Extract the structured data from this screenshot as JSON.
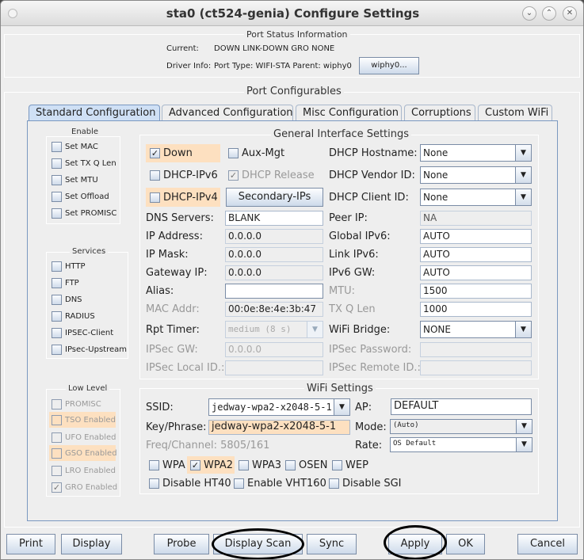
{
  "window": {
    "title": "sta0  (ct524-genia) Configure Settings",
    "controls": [
      "minimize",
      "maximize",
      "close"
    ]
  },
  "port_status": {
    "heading": "Port Status Information",
    "current_label": "Current:",
    "current_value": "DOWN LINK-DOWN GRO  NONE",
    "driver_label": "Driver Info:",
    "driver_value": "Port Type: WIFI-STA   Parent: wiphy0",
    "wiphy_button": "wiphy0..."
  },
  "configurables_heading": "Port Configurables",
  "tabs": [
    {
      "label": "Standard Configuration",
      "active": true
    },
    {
      "label": "Advanced Configuration",
      "active": false
    },
    {
      "label": "Misc Configuration",
      "active": false
    },
    {
      "label": "Corruptions",
      "active": false
    },
    {
      "label": "Custom WiFi",
      "active": false
    }
  ],
  "enable": {
    "heading": "Enable",
    "items": [
      {
        "label": "Set MAC",
        "checked": false
      },
      {
        "label": "Set TX Q Len",
        "checked": false
      },
      {
        "label": "Set MTU",
        "checked": false
      },
      {
        "label": "Set Offload",
        "checked": false
      },
      {
        "label": "Set PROMISC",
        "checked": false
      }
    ]
  },
  "services": {
    "heading": "Services",
    "items": [
      {
        "label": "HTTP",
        "checked": false
      },
      {
        "label": "FTP",
        "checked": false
      },
      {
        "label": "DNS",
        "checked": false
      },
      {
        "label": "RADIUS",
        "checked": false
      },
      {
        "label": "IPSEC-Client",
        "checked": false
      },
      {
        "label": "IPsec-Upstream",
        "checked": false
      }
    ]
  },
  "low_level": {
    "heading": "Low Level",
    "items": [
      {
        "label": "PROMISC",
        "checked": false,
        "highlight": false
      },
      {
        "label": "TSO Enabled",
        "checked": false,
        "highlight": true
      },
      {
        "label": "UFO Enabled",
        "checked": false,
        "highlight": false
      },
      {
        "label": "GSO Enabled",
        "checked": false,
        "highlight": true
      },
      {
        "label": "LRO Enabled",
        "checked": false,
        "highlight": false
      },
      {
        "label": "GRO Enabled",
        "checked": true,
        "highlight": false
      }
    ]
  },
  "general": {
    "heading": "General Interface Settings",
    "down": {
      "label": "Down",
      "checked": true
    },
    "aux_mgt": {
      "label": "Aux-Mgt",
      "checked": false
    },
    "dhcp_ipv6": {
      "label": "DHCP-IPv6",
      "checked": false
    },
    "dhcp_release": {
      "label": "DHCP Release",
      "checked": true
    },
    "dhcp_ipv4": {
      "label": "DHCP-IPv4",
      "checked": false
    },
    "secondary_ips_button": "Secondary-IPs",
    "dhcp_hostname": {
      "label": "DHCP Hostname:",
      "value": "None"
    },
    "dhcp_vendor_id": {
      "label": "DHCP Vendor ID:",
      "value": "None"
    },
    "dhcp_client_id": {
      "label": "DHCP Client ID:",
      "value": "None"
    },
    "dns_servers": {
      "label": "DNS Servers:",
      "value": "BLANK"
    },
    "peer_ip": {
      "label": "Peer IP:",
      "value": "NA"
    },
    "ip_address": {
      "label": "IP Address:",
      "value": "0.0.0.0"
    },
    "global_ipv6": {
      "label": "Global IPv6:",
      "value": "AUTO"
    },
    "ip_mask": {
      "label": "IP Mask:",
      "value": "0.0.0.0"
    },
    "link_ipv6": {
      "label": "Link IPv6:",
      "value": "AUTO"
    },
    "gateway_ip": {
      "label": "Gateway IP:",
      "value": "0.0.0.0"
    },
    "ipv6_gw": {
      "label": "IPv6 GW:",
      "value": "AUTO"
    },
    "alias": {
      "label": "Alias:",
      "value": ""
    },
    "mtu": {
      "label": "MTU:",
      "value": "1500"
    },
    "mac_addr": {
      "label": "MAC Addr:",
      "value": "00:0e:8e:4e:3b:47"
    },
    "tx_q_len": {
      "label": "TX Q Len",
      "value": "1000"
    },
    "rpt_timer": {
      "label": "Rpt Timer:",
      "value": "medium  (8 s)"
    },
    "wifi_bridge": {
      "label": "WiFi Bridge:",
      "value": "NONE"
    },
    "ipsec_gw": {
      "label": "IPSec GW:",
      "value": "0.0.0.0"
    },
    "ipsec_password": {
      "label": "IPSec Password:",
      "value": ""
    },
    "ipsec_local_id": {
      "label": "IPSec Local ID.:",
      "value": ""
    },
    "ipsec_remote_id": {
      "label": "IPSec Remote ID.:",
      "value": ""
    }
  },
  "wifi": {
    "heading": "WiFi Settings",
    "ssid": {
      "label": "SSID:",
      "value": "jedway-wpa2-x2048-5-1"
    },
    "ap": {
      "label": "AP:",
      "value": "DEFAULT"
    },
    "key": {
      "label": "Key/Phrase:",
      "value": "jedway-wpa2-x2048-5-1"
    },
    "mode": {
      "label": "Mode:",
      "value": "(Auto)"
    },
    "freq": "Freq/Channel: 5805/161",
    "rate": {
      "label": "Rate:",
      "value": "OS Default"
    },
    "security": [
      {
        "label": "WPA",
        "checked": false
      },
      {
        "label": "WPA2",
        "checked": true
      },
      {
        "label": "WPA3",
        "checked": false
      },
      {
        "label": "OSEN",
        "checked": false
      },
      {
        "label": "WEP",
        "checked": false
      }
    ],
    "options": [
      {
        "label": "Disable HT40",
        "checked": false
      },
      {
        "label": "Enable VHT160",
        "checked": false
      },
      {
        "label": "Disable SGI",
        "checked": false
      }
    ]
  },
  "buttons": {
    "print": "Print",
    "display": "Display",
    "probe": "Probe",
    "display_scan": "Display Scan",
    "sync": "Sync",
    "apply": "Apply",
    "ok": "OK",
    "cancel": "Cancel"
  },
  "annotations": [
    "circled: Display Scan",
    "circled: Apply"
  ],
  "colors": {
    "highlight": "#fde0c0",
    "active_tab": "#cfe0f5",
    "panel_border": "#7a98c0"
  }
}
